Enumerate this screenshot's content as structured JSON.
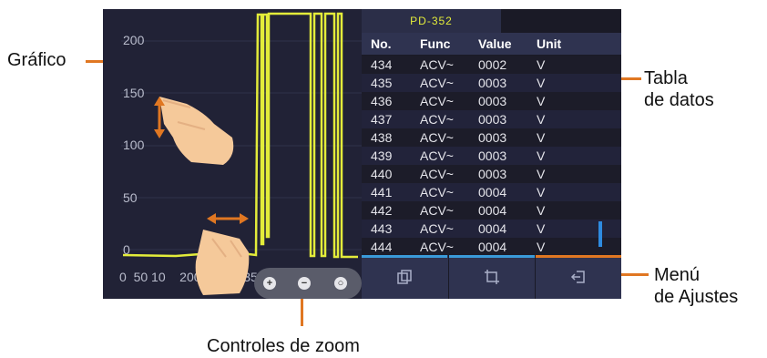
{
  "callouts": {
    "graph": "Gráfico",
    "table": [
      "Tabla",
      "de datos"
    ],
    "menu": [
      "Menú",
      "de Ajustes"
    ],
    "zoom": "Controles de zoom"
  },
  "graph": {
    "y_ticks": [
      "200",
      "150",
      "100",
      "50",
      "0"
    ],
    "x_ticks": "0  50 10    200250300350400",
    "line_color": "#e3ec3a"
  },
  "zoom": {
    "buttons": [
      "zoom-in",
      "zoom-out",
      "zoom-reset"
    ]
  },
  "table": {
    "tab_label": "PD-352",
    "headers": [
      "No.",
      "Func",
      "Value",
      "Unit"
    ],
    "rows": [
      [
        "434",
        "ACV~",
        "0002",
        "V"
      ],
      [
        "435",
        "ACV~",
        "0003",
        "V"
      ],
      [
        "436",
        "ACV~",
        "0003",
        "V"
      ],
      [
        "437",
        "ACV~",
        "0003",
        "V"
      ],
      [
        "438",
        "ACV~",
        "0003",
        "V"
      ],
      [
        "439",
        "ACV~",
        "0003",
        "V"
      ],
      [
        "440",
        "ACV~",
        "0003",
        "V"
      ],
      [
        "441",
        "ACV~",
        "0004",
        "V"
      ],
      [
        "442",
        "ACV~",
        "0004",
        "V"
      ],
      [
        "443",
        "ACV~",
        "0004",
        "V"
      ],
      [
        "444",
        "ACV~",
        "0004",
        "V"
      ]
    ]
  },
  "menu": {
    "items": [
      {
        "icon": "copy-icon",
        "accent": "#3a9ad9"
      },
      {
        "icon": "crop-icon",
        "accent": "#3a9ad9"
      },
      {
        "icon": "exit-icon",
        "accent": "#e07722"
      }
    ]
  },
  "colors": {
    "accent_orange": "#e07722",
    "screen_bg": "#1d1d2b",
    "header_bg": "#2f3350",
    "tab_text": "#e3ec3a"
  }
}
